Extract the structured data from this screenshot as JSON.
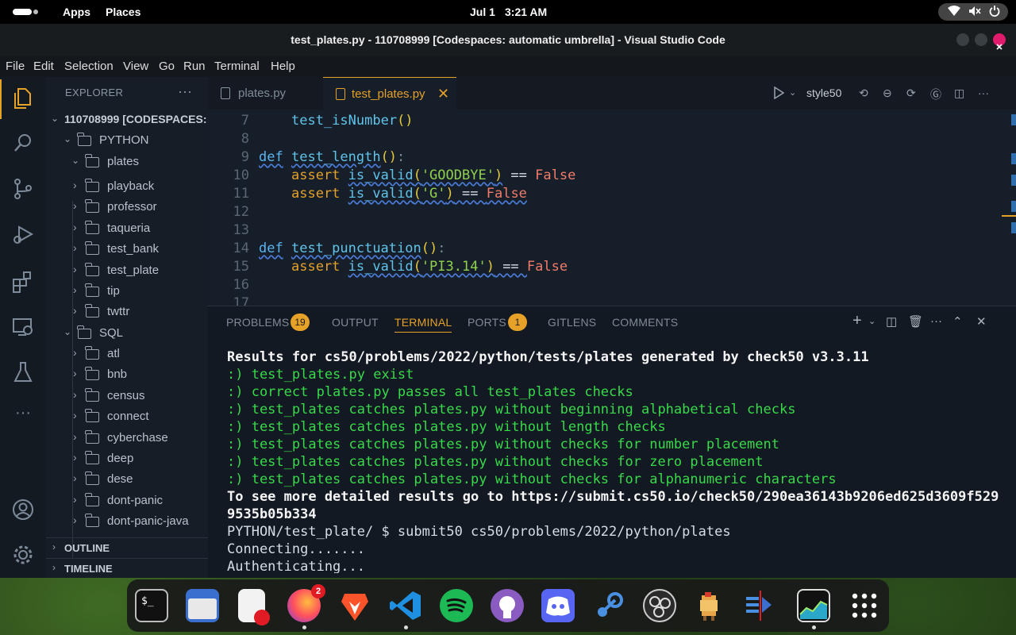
{
  "topbar": {
    "apps": "Apps",
    "places": "Places",
    "date": "Jul 1",
    "time": "3:21 AM"
  },
  "window": {
    "title": "test_plates.py - 110708999 [Codespaces: automatic umbrella] - Visual Studio Code"
  },
  "menu": [
    "File",
    "Edit",
    "Selection",
    "View",
    "Go",
    "Run",
    "Terminal",
    "Help"
  ],
  "sidebar": {
    "header": "EXPLORER",
    "root": "110708999 [CODESPACES: ...",
    "python_folder": "PYTHON",
    "plates_folder": "plates",
    "python_items": [
      "playback",
      "professor",
      "taqueria",
      "test_bank",
      "test_plate",
      "tip",
      "twttr"
    ],
    "sql_folder": "SQL",
    "sql_items": [
      "atl",
      "bnb",
      "census",
      "connect",
      "cyberchase",
      "deep",
      "dese",
      "dont-panic",
      "dont-panic-java"
    ],
    "outline": "OUTLINE",
    "timeline": "TIMELINE"
  },
  "tabs": {
    "tab1": "plates.py",
    "tab2": "test_plates.py",
    "style_label": "style50"
  },
  "code": {
    "line_numbers": [
      "7",
      "8",
      "9",
      "10",
      "11",
      "12",
      "13",
      "14",
      "15",
      "16",
      "17"
    ],
    "l7": "test_isNumber",
    "kw_def": "def",
    "kw_assert": "assert",
    "fn_length": "test_length",
    "fn_punct": "test_punctuation",
    "is_valid": "is_valid",
    "s_goodbye": "'GOODBYE'",
    "s_g": "'G'",
    "s_pi": "'PI3.14'",
    "eq": " == ",
    "false": "False"
  },
  "panel": {
    "problems": "PROBLEMS",
    "problems_count": "19",
    "output": "OUTPUT",
    "terminal": "TERMINAL",
    "ports": "PORTS",
    "ports_count": "1",
    "gitlens": "GITLENS",
    "comments": "COMMENTS"
  },
  "terminal_lines": {
    "header": "Results for cs50/problems/2022/python/tests/plates generated by check50 v3.3.11",
    "c1": ":) test_plates.py exist",
    "c2": ":) correct plates.py passes all test_plates checks",
    "c3": ":) test_plates catches plates.py without beginning alphabetical checks",
    "c4": ":) test_plates catches plates.py without length checks",
    "c5": ":) test_plates catches plates.py without checks for number placement",
    "c6": ":) test_plates catches plates.py without checks for zero placement",
    "c7": ":) test_plates catches plates.py without checks for alphanumeric characters",
    "more1": "To see more detailed results go to https://submit.cs50.io/check50/290ea36143b9206ed625d3609f529",
    "more2": "9535b05b334",
    "prompt": "PYTHON/test_plate/ $ submit50 cs50/problems/2022/python/plates",
    "connecting": "Connecting.......",
    "auth": "Authenticating..."
  },
  "dock": {
    "firefox_badge": "2",
    "terminal_glyph": "$_"
  }
}
